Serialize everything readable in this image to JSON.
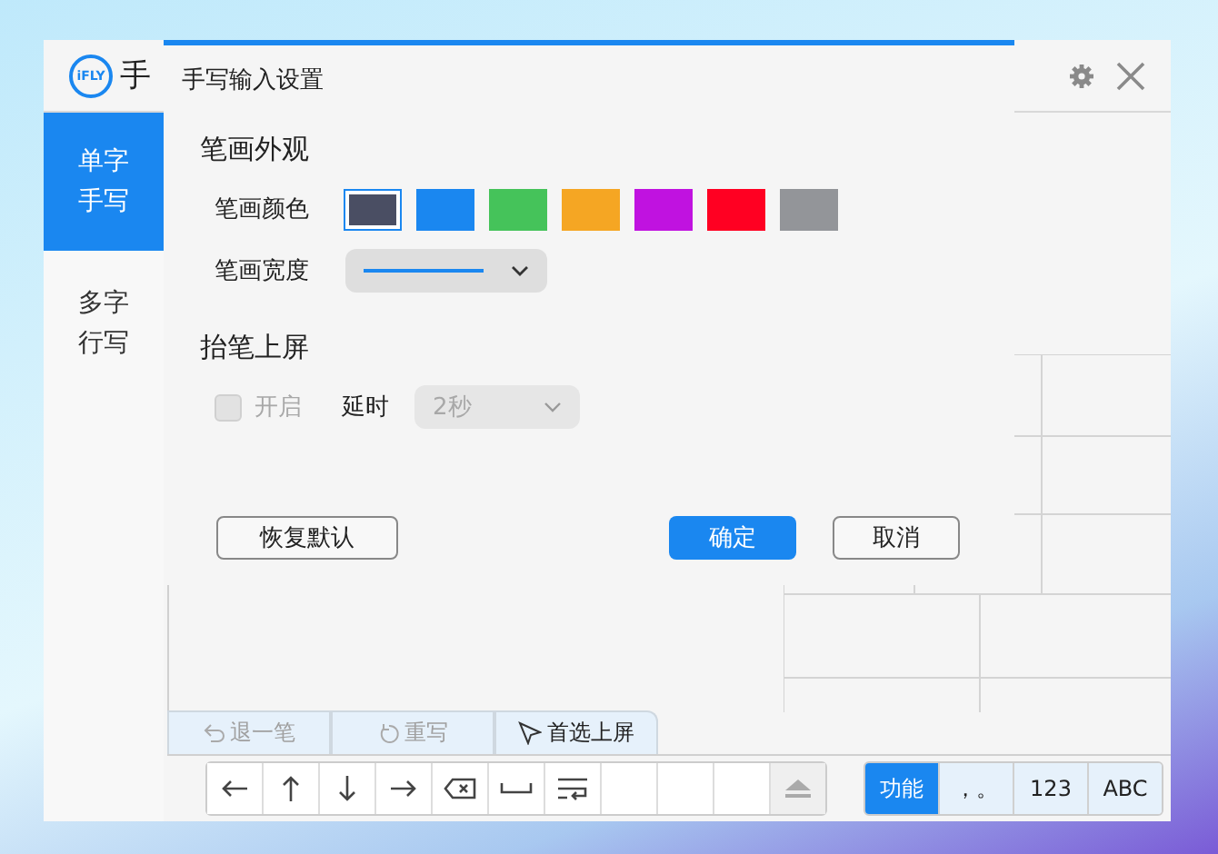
{
  "app": {
    "logo": "iFLY",
    "title": "手"
  },
  "sidebar": [
    {
      "lines": [
        "单字",
        "手写"
      ],
      "selected": true
    },
    {
      "lines": [
        "多字",
        "行写"
      ],
      "selected": false
    }
  ],
  "action_tabs": [
    {
      "label": "退一笔",
      "kind": "undo",
      "disabled": true
    },
    {
      "label": "重写",
      "kind": "redo",
      "disabled": true
    },
    {
      "label": "首选上屏",
      "kind": "pointer",
      "disabled": false
    }
  ],
  "keys": [
    {
      "kind": "left"
    },
    {
      "kind": "up"
    },
    {
      "kind": "down"
    },
    {
      "kind": "right"
    },
    {
      "kind": "backspace"
    },
    {
      "kind": "space"
    },
    {
      "kind": "enter"
    },
    {
      "kind": "blank"
    },
    {
      "kind": "blank"
    },
    {
      "kind": "blank"
    },
    {
      "kind": "eject"
    }
  ],
  "mode_keys": [
    {
      "label": "功能",
      "selected": true
    },
    {
      "label": "，。",
      "selected": false
    },
    {
      "label": "123",
      "selected": false
    },
    {
      "label": "ABC",
      "selected": false
    }
  ],
  "dialog": {
    "title": "手写输入设置",
    "appearance": {
      "heading": "笔画外观",
      "color_label": "笔画颜色",
      "colors": [
        {
          "color": "#4a4e63",
          "selected": true
        },
        {
          "color": "#1a87f0",
          "selected": false
        },
        {
          "color": "#45c35a",
          "selected": false
        },
        {
          "color": "#f5a623",
          "selected": false
        },
        {
          "color": "#c012e0",
          "selected": false
        },
        {
          "color": "#ff0022",
          "selected": false
        },
        {
          "color": "#939599",
          "selected": false
        }
      ],
      "width_label": "笔画宽度"
    },
    "lift": {
      "heading": "抬笔上屏",
      "checkbox_label": "开启",
      "checked": false,
      "disabled": true,
      "delay_label": "延时",
      "delay_value": "2秒",
      "delay_disabled": true
    },
    "buttons": [
      {
        "label": "恢复默认",
        "kind": "secondary"
      },
      {
        "label": "确定",
        "kind": "primary"
      },
      {
        "label": "取消",
        "kind": "secondary"
      }
    ]
  }
}
